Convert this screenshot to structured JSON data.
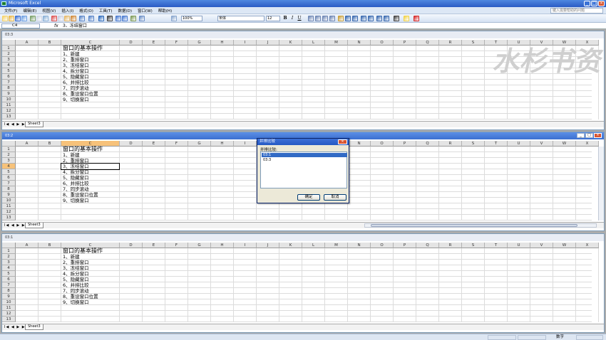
{
  "app": {
    "title": "Microsoft Excel"
  },
  "menu": {
    "items": [
      "文件(F)",
      "编辑(E)",
      "视图(V)",
      "插入(I)",
      "格式(O)",
      "工具(T)",
      "数据(D)",
      "窗口(W)",
      "帮助(H)"
    ],
    "help_placeholder": "键入需要帮助的问题"
  },
  "toolbar": {
    "zoom": "100%",
    "font": "宋体",
    "size": "12"
  },
  "formula_bar": {
    "name_box": "C4",
    "fx": "fx",
    "content": "3、冻结窗口"
  },
  "columns": [
    "A",
    "B",
    "C",
    "D",
    "E",
    "F",
    "G",
    "H",
    "I",
    "J",
    "K",
    "L",
    "M",
    "N",
    "O",
    "P",
    "Q",
    "R",
    "S",
    "T",
    "U",
    "V",
    "W",
    "X"
  ],
  "rows": [
    "1",
    "2",
    "3",
    "4",
    "5",
    "6",
    "7",
    "8",
    "9",
    "10",
    "11",
    "12",
    "13"
  ],
  "content": {
    "title": "窗口的基本操作",
    "items": [
      "1、新建",
      "2、重排窗口",
      "3、冻结窗口",
      "4、拆分窗口",
      "5、隐藏窗口",
      "6、并排比较",
      "7、同步滚动",
      "8、重设窗口位置",
      "9、切换窗口"
    ]
  },
  "panes": [
    {
      "title": "03:3",
      "sheet_tab": "Sheet3",
      "nav": "I◀ ◀ ▶ ▶I"
    },
    {
      "title": "03:2",
      "sheet_tab": "Sheet3",
      "nav": "I◀ ◀ ▶ ▶I"
    },
    {
      "title": "03:1",
      "sheet_tab": "Sheet3",
      "nav": "I◀ ◀ ▶ ▶I"
    }
  ],
  "dialog": {
    "title": "并排比较",
    "label": "并排比较:",
    "list": [
      "03:1",
      "03:3"
    ],
    "ok": "确定",
    "cancel": "取消"
  },
  "watermark": "水杉书资",
  "status": {
    "mode": "数字"
  },
  "accent_colors": {
    "selected_header": "#f7c27a",
    "title_blue": "#2a5bc4",
    "selection": "#316ac5"
  }
}
